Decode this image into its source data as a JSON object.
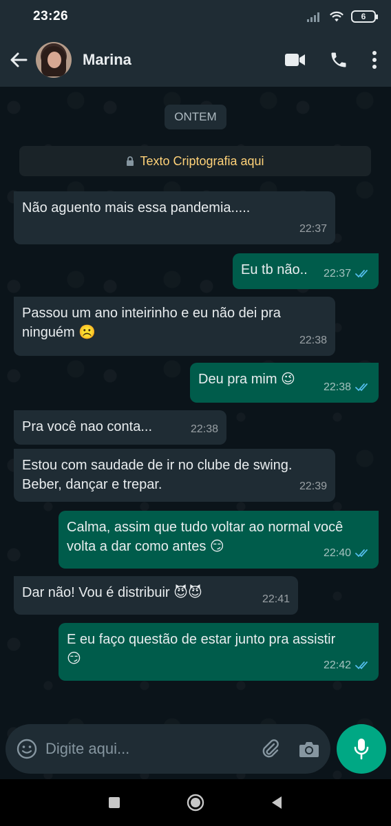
{
  "status_bar": {
    "time": "23:26",
    "battery": "6"
  },
  "header": {
    "contact_name": "Marina"
  },
  "chat": {
    "date_label": "ONTEM",
    "encryption_text": "Texto Criptografia aqui",
    "messages": [
      {
        "dir": "in",
        "text": "Não aguento mais essa pandemia.....",
        "time": "22:37"
      },
      {
        "dir": "out",
        "text": "Eu tb não..",
        "time": "22:37",
        "read": true
      },
      {
        "dir": "in",
        "text": "Passou um ano inteirinho e eu não dei pra ninguém ☹️",
        "time": "22:38"
      },
      {
        "dir": "out",
        "text": "Deu pra mim 😉",
        "time": "22:38",
        "read": true
      },
      {
        "dir": "in",
        "text": "Pra você nao conta...",
        "time": "22:38"
      },
      {
        "dir": "in",
        "text": "Estou com saudade de ir no clube de swing. Beber, dançar e trepar.",
        "time": "22:39"
      },
      {
        "dir": "out",
        "text": "Calma, assim que tudo voltar ao normal você volta a dar como antes 😏",
        "time": "22:40",
        "read": true
      },
      {
        "dir": "in",
        "text": "Dar não! Vou é distribuir 😈😈",
        "time": "22:41"
      },
      {
        "dir": "out",
        "text": "E eu faço questão de estar junto pra assistir 😏",
        "time": "22:42",
        "read": true
      }
    ]
  },
  "composer": {
    "placeholder": "Digite aqui..."
  },
  "colors": {
    "incoming": "#1f2c34",
    "outgoing": "#005c4b",
    "accent": "#00a884",
    "read_tick": "#53bdeb"
  }
}
